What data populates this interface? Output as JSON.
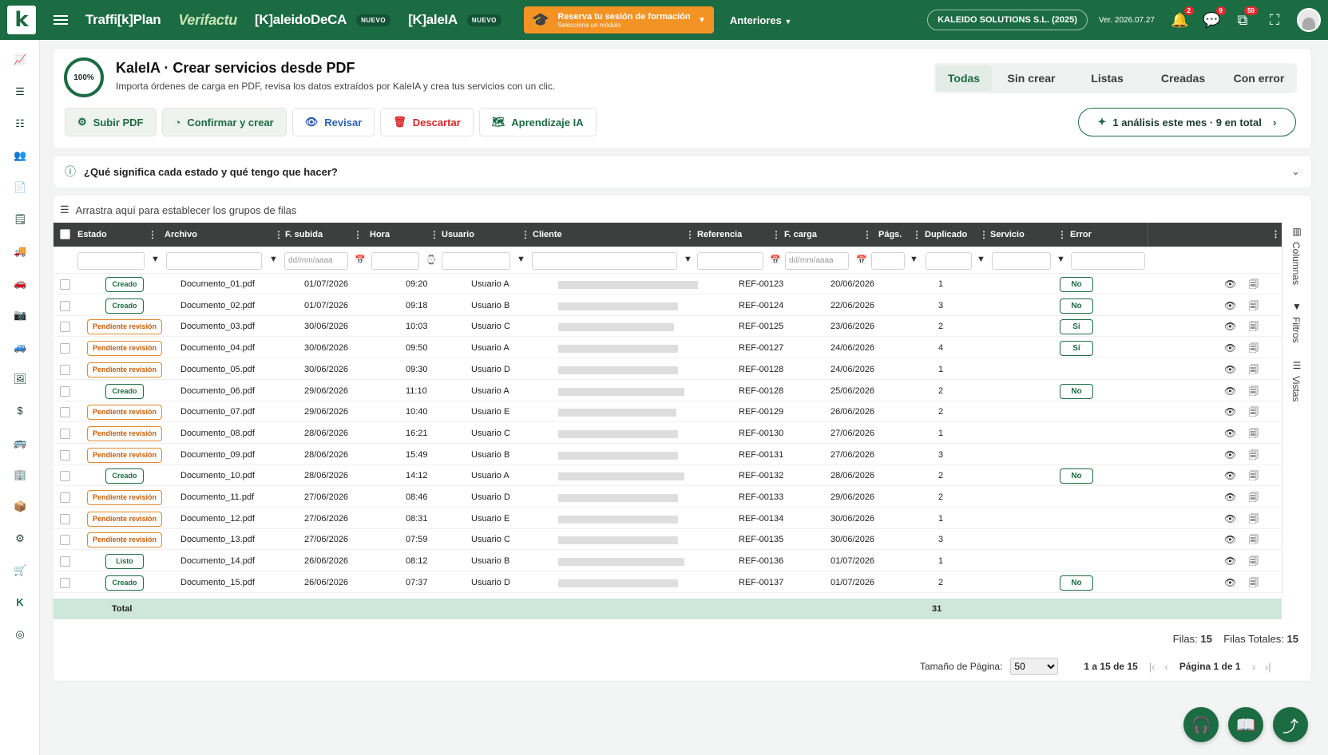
{
  "topbar": {
    "logo": "k",
    "brands": [
      "Traffi[k]Plan",
      "Verifactu",
      "[K]aleidoDeCA",
      "[K]aleIA"
    ],
    "new_badge": "NUEVO",
    "training_title": "Reserva tu sesión de formación",
    "training_sub": "Selecciona un módulo",
    "anteriores": "Anteriores",
    "company": "KALEIDO SOLUTIONS S.L. (2025)",
    "version": "Ver. 2026.07.27",
    "notif_count": "2",
    "chat_count": "9",
    "tasks_count": "59",
    "icons": [
      "menu-icon",
      "graduation-cap-icon",
      "bell-icon",
      "chat-icon",
      "tasks-icon",
      "fullscreen-icon",
      "avatar-icon"
    ],
    "accent": "#1b6b43",
    "training_color": "#f39324"
  },
  "sidebar": {
    "icons": [
      "chart-icon",
      "list-icon",
      "checklist-icon",
      "users-icon",
      "document-icon",
      "report-icon",
      "truck-icon",
      "car-icon",
      "camera-icon",
      "vehicle-icon",
      "image-icon",
      "dollar-icon",
      "bus-icon",
      "building-icon",
      "box-icon",
      "gear-icon",
      "cart-icon",
      "kaleido-icon",
      "support-icon"
    ]
  },
  "header": {
    "progress": "100%",
    "title": "KaleIA · Crear servicios desde PDF",
    "subtitle": "Importa órdenes de carga en PDF, revisa los datos extraídos por KaleIA y crea tus servicios con un clic.",
    "actions": [
      "Subir PDF",
      "Confirmar y crear",
      "Revisar",
      "Descartar",
      "Aprendizaje IA"
    ],
    "tabs": [
      "Todas",
      "Sin crear",
      "Listas",
      "Creadas",
      "Con error"
    ],
    "active_tab": "Todas",
    "analysis": "1 análisis este mes · 9 en total"
  },
  "help": {
    "question": "¿Qué significa cada estado y qué tengo que hacer?"
  },
  "grid": {
    "group_hint": "Arrastra aquí para establecer los grupos de filas",
    "columns": [
      "Estado",
      "Archivo",
      "F. subida",
      "Hora",
      "Usuario",
      "Cliente",
      "Referencia",
      "F. carga",
      "Págs.",
      "Duplicado",
      "Servicio",
      "Error"
    ],
    "date_placeholder": "dd/mm/aaaa",
    "rows": [
      {
        "estado": "Creado",
        "archivo": "Documento_01.pdf",
        "subida": "01/07/2026",
        "hora": "09:20",
        "usuario": "Usuario A",
        "ref": "REF-00123",
        "carga": "20/06/2026",
        "pags": "1",
        "servicio": "No"
      },
      {
        "estado": "Creado",
        "archivo": "Documento_02.pdf",
        "subida": "01/07/2026",
        "hora": "09:18",
        "usuario": "Usuario B",
        "ref": "REF-00124",
        "carga": "22/06/2026",
        "pags": "3",
        "servicio": "No"
      },
      {
        "estado": "Pendiente revisión",
        "archivo": "Documento_03.pdf",
        "subida": "30/06/2026",
        "hora": "10:03",
        "usuario": "Usuario C",
        "ref": "REF-00125",
        "carga": "23/06/2026",
        "pags": "2",
        "servicio": "Sí"
      },
      {
        "estado": "Pendiente revisión",
        "archivo": "Documento_04.pdf",
        "subida": "30/06/2026",
        "hora": "09:50",
        "usuario": "Usuario A",
        "ref": "REF-00127",
        "carga": "24/06/2026",
        "pags": "4",
        "servicio": "Sí"
      },
      {
        "estado": "Pendiente revisión",
        "archivo": "Documento_05.pdf",
        "subida": "30/06/2026",
        "hora": "09:30",
        "usuario": "Usuario D",
        "ref": "REF-00128",
        "carga": "24/06/2026",
        "pags": "1",
        "servicio": ""
      },
      {
        "estado": "Creado",
        "archivo": "Documento_06.pdf",
        "subida": "29/06/2026",
        "hora": "11:10",
        "usuario": "Usuario A",
        "ref": "REF-00128",
        "carga": "25/06/2026",
        "pags": "2",
        "servicio": "No"
      },
      {
        "estado": "Pendiente revisión",
        "archivo": "Documento_07.pdf",
        "subida": "29/06/2026",
        "hora": "10:40",
        "usuario": "Usuario E",
        "ref": "REF-00129",
        "carga": "26/06/2026",
        "pags": "2",
        "servicio": ""
      },
      {
        "estado": "Pendiente revisión",
        "archivo": "Documento_08.pdf",
        "subida": "28/06/2026",
        "hora": "16:21",
        "usuario": "Usuario C",
        "ref": "REF-00130",
        "carga": "27/06/2026",
        "pags": "1",
        "servicio": ""
      },
      {
        "estado": "Pendiente revisión",
        "archivo": "Documento_09.pdf",
        "subida": "28/06/2026",
        "hora": "15:49",
        "usuario": "Usuario B",
        "ref": "REF-00131",
        "carga": "27/06/2026",
        "pags": "3",
        "servicio": ""
      },
      {
        "estado": "Creado",
        "archivo": "Documento_10.pdf",
        "subida": "28/06/2026",
        "hora": "14:12",
        "usuario": "Usuario A",
        "ref": "REF-00132",
        "carga": "28/06/2026",
        "pags": "2",
        "servicio": "No"
      },
      {
        "estado": "Pendiente revisión",
        "archivo": "Documento_11.pdf",
        "subida": "27/06/2026",
        "hora": "08:46",
        "usuario": "Usuario D",
        "ref": "REF-00133",
        "carga": "29/06/2026",
        "pags": "2",
        "servicio": ""
      },
      {
        "estado": "Pendiente revisión",
        "archivo": "Documento_12.pdf",
        "subida": "27/06/2026",
        "hora": "08:31",
        "usuario": "Usuario E",
        "ref": "REF-00134",
        "carga": "30/06/2026",
        "pags": "1",
        "servicio": ""
      },
      {
        "estado": "Pendiente revisión",
        "archivo": "Documento_13.pdf",
        "subida": "27/06/2026",
        "hora": "07:59",
        "usuario": "Usuario C",
        "ref": "REF-00135",
        "carga": "30/06/2026",
        "pags": "3",
        "servicio": ""
      },
      {
        "estado": "Listo",
        "archivo": "Documento_14.pdf",
        "subida": "26/06/2026",
        "hora": "08:12",
        "usuario": "Usuario B",
        "ref": "REF-00136",
        "carga": "01/07/2026",
        "pags": "1",
        "servicio": ""
      },
      {
        "estado": "Creado",
        "archivo": "Documento_15.pdf",
        "subida": "26/06/2026",
        "hora": "07:37",
        "usuario": "Usuario D",
        "ref": "REF-00137",
        "carga": "01/07/2026",
        "pags": "2",
        "servicio": "No"
      }
    ],
    "total_label": "Total",
    "total_pags": "31",
    "side_panels": [
      "Columnas",
      "Filtros",
      "Vistas"
    ]
  },
  "footer": {
    "filas_label": "Filas:",
    "filas": "15",
    "totales_label": "Filas Totales:",
    "totales": "15",
    "page_size_label": "Tamaño de Página:",
    "page_size": "50",
    "range": "1 a 15 de 15",
    "page": "Página 1 de 1"
  },
  "fabs": [
    "headset-icon",
    "book-icon",
    "share-icon"
  ]
}
